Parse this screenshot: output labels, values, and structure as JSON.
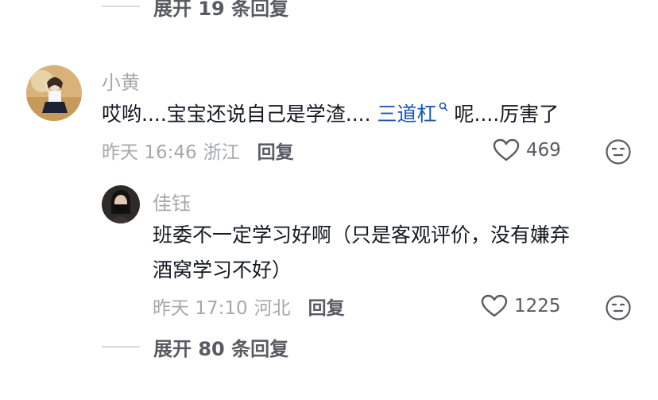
{
  "top_expand": {
    "label": "展开 19 条回复"
  },
  "comment": {
    "username": "小黄",
    "text_before": "哎哟....宝宝还说自己是学渣.... ",
    "link_text": "三道杠",
    "text_after": " 呢....厉害了",
    "time": "昨天 16:46",
    "location": "浙江",
    "reply_label": "回复",
    "like_count": "469"
  },
  "reply": {
    "username": "佳钰",
    "line1": "班委不一定学习好啊（只是客观评价，没有嫌弃",
    "line2": "酒窝学习不好）",
    "time": "昨天 17:10",
    "location": "河北",
    "reply_label": "回复",
    "like_count": "1225"
  },
  "bottom_expand": {
    "label": "展开 80 条回复"
  },
  "colors": {
    "text": "#161823",
    "muted": "#a7a8ad",
    "link": "#1a57b5",
    "secondary": "#5a5a63"
  }
}
